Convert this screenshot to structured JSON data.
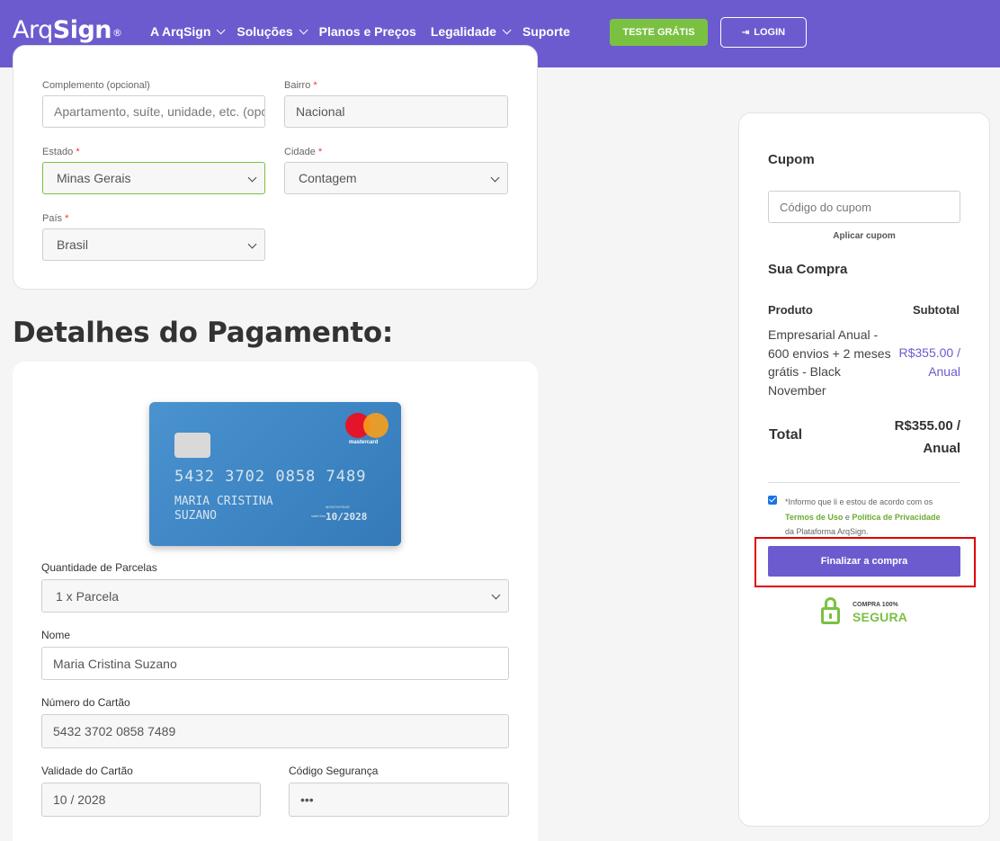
{
  "header": {
    "logo_a": "Arq",
    "logo_b": "Sign",
    "logo_reg": "®",
    "nav": [
      {
        "label": "A ArqSign",
        "dropdown": true
      },
      {
        "label": "Soluções",
        "dropdown": true
      },
      {
        "label": "Planos e Preços",
        "dropdown": false
      },
      {
        "label": "Legalidade",
        "dropdown": true
      },
      {
        "label": "Suporte",
        "dropdown": false
      }
    ],
    "trial_label": "TESTE GRÁTIS",
    "login_label": "LOGIN",
    "brand_color": "#6c5bcf",
    "accent_green": "#7ac142"
  },
  "address": {
    "complemento": {
      "label": "Complemento (opcional)",
      "placeholder": "Apartamento, suíte, unidade, etc. (opcional)"
    },
    "bairro": {
      "label": "Bairro",
      "required": "*",
      "value": "Nacional"
    },
    "estado": {
      "label": "Estado",
      "required": "*",
      "value": "Minas Gerais"
    },
    "cidade": {
      "label": "Cidade",
      "required": "*",
      "value": "Contagem"
    },
    "pais": {
      "label": "País",
      "required": "*",
      "value": "Brasil"
    }
  },
  "payment": {
    "title": "Detalhes do Pagamento:",
    "card_preview": {
      "brand": "mastercard",
      "number": "5432 3702 0858 7489",
      "holder": "MARIA CRISTINA SUZANO",
      "month_year": "MONTH/YEAR",
      "valid_thru": "valid thru",
      "expiry": "10/2028"
    },
    "installments": {
      "label": "Quantidade de Parcelas",
      "value": "1 x Parcela"
    },
    "name": {
      "label": "Nome",
      "value": "Maria Cristina Suzano"
    },
    "card_number": {
      "label": "Número do Cartão",
      "value": "5432 3702 0858 7489"
    },
    "expiry": {
      "label": "Validade do Cartão",
      "value": "10 / 2028"
    },
    "cvv": {
      "label": "Código Segurança",
      "value": "•••"
    }
  },
  "sidebar": {
    "coupon_title": "Cupom",
    "coupon_placeholder": "Código do cupom",
    "apply_label": "Aplicar cupom",
    "purchase_title": "Sua Compra",
    "col_product": "Produto",
    "col_subtotal": "Subtotal",
    "product_name": "Empresarial Anual - 600 envios + 2 meses grátis - Black November",
    "product_price": "R$355.00 / Anual",
    "total_label": "Total",
    "total_value": "R$355.00 / Anual",
    "terms_prefix": "*Informo que li e estou de acordo com os",
    "terms_link": "Termos de Uso",
    "terms_and": "e",
    "privacy_link": "Política de Privacidade",
    "terms_suffix": "da Plataforma ArqSign.",
    "terms_checked": true,
    "buy_label": "Finalizar a compra",
    "secure_line1": "COMPRA 100%",
    "secure_line2": "SEGURA"
  }
}
